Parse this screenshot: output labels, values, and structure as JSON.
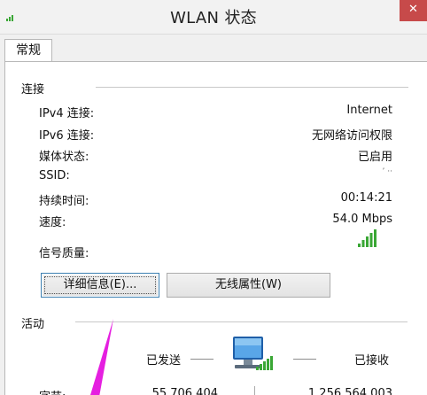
{
  "window": {
    "title": "WLAN 状态"
  },
  "tabs": [
    {
      "label": "常规"
    }
  ],
  "connection": {
    "section_label": "连接",
    "rows": [
      {
        "label": "IPv4 连接:",
        "value": "Internet"
      },
      {
        "label": "IPv6 连接:",
        "value": "无网络访问权限"
      },
      {
        "label": "媒体状态:",
        "value": "已启用"
      },
      {
        "label": "SSID:",
        "value": "ʼ ··"
      },
      {
        "label": "持续时间:",
        "value": "00:14:21"
      },
      {
        "label": "速度:",
        "value": "54.0 Mbps"
      }
    ],
    "signal_label": "信号质量:",
    "signal_bars": 5,
    "signal_max": 5
  },
  "buttons": {
    "details": "详细信息(E)...",
    "wireless_properties": "无线属性(W)"
  },
  "activity": {
    "section_label": "活动",
    "sent_label": "已发送",
    "received_label": "已接收",
    "bytes_label": "字节:",
    "bytes_sent": "55,706,404",
    "bytes_received": "1,256,564,003"
  },
  "icons": {
    "title_icon": "wifi-signal-icon",
    "network_icon": "network-computer-icon",
    "annotation": "magenta-arrow-icon"
  },
  "colors": {
    "close_button": "#c74a4a",
    "signal_green": "#3aa735",
    "arrow_magenta": "#e51fe0"
  }
}
